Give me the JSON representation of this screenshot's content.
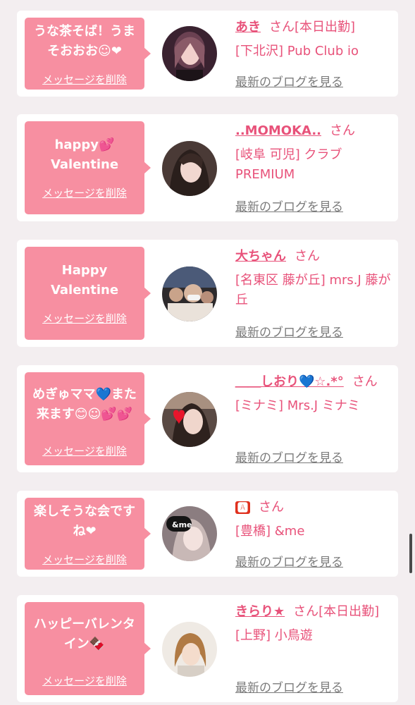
{
  "cards": [
    {
      "message": "うな茶そば！うまそおおお☺❤",
      "delete_label": "メッセージを削除",
      "name": "あき",
      "honorific": "さん[本日出勤]",
      "shop": "[下北沢] Pub Club io",
      "blog_label": "最新のブログを見る",
      "avatar": "woman-portrait-dark-hair"
    },
    {
      "message": "happy💕 Valentine",
      "delete_label": "メッセージを削除",
      "name": "..MOMOKA..",
      "honorific": "さん",
      "shop": "[岐阜 可児] クラブ PREMIUM",
      "blog_label": "最新のブログを見る",
      "avatar": "woman-portrait-long-hair"
    },
    {
      "message": "Happy Valentine",
      "delete_label": "メッセージを削除",
      "name": "大ちゃん",
      "honorific": "さん",
      "shop": "[名東区 藤が丘] mrs.J 藤が丘",
      "blog_label": "最新のブログを見る",
      "avatar": "man-with-mask-photo"
    },
    {
      "message": "めぎゅママ💙また来ます😊☺💕💕",
      "delete_label": "メッセージを削除",
      "name": "＿＿しおり💙☆.*°",
      "honorific": "さん",
      "shop": "[ミナミ] Mrs.J ミナミ",
      "blog_label": "最新のブログを見る",
      "avatar": "woman-with-heart-sticker"
    },
    {
      "message": "楽しそうな会ですね❤",
      "delete_label": "メッセージを削除",
      "name": "🅰",
      "honorific": "さん",
      "shop": "[豊橋] &me",
      "blog_label": "最新のブログを見る",
      "avatar": "woman-with-me-sticker"
    },
    {
      "message": "ハッピーバレンタイン🍫",
      "delete_label": "メッセージを削除",
      "name": "きらり★",
      "honorific": "さん[本日出勤]",
      "shop": "[上野] 小鳥遊",
      "blog_label": "最新のブログを見る",
      "avatar": "woman-short-brown-hair"
    }
  ],
  "colors": {
    "bubble": "#f78fa1",
    "accent": "#e8527a",
    "link_gray": "#7b7b7b",
    "background": "#f3eef0"
  }
}
